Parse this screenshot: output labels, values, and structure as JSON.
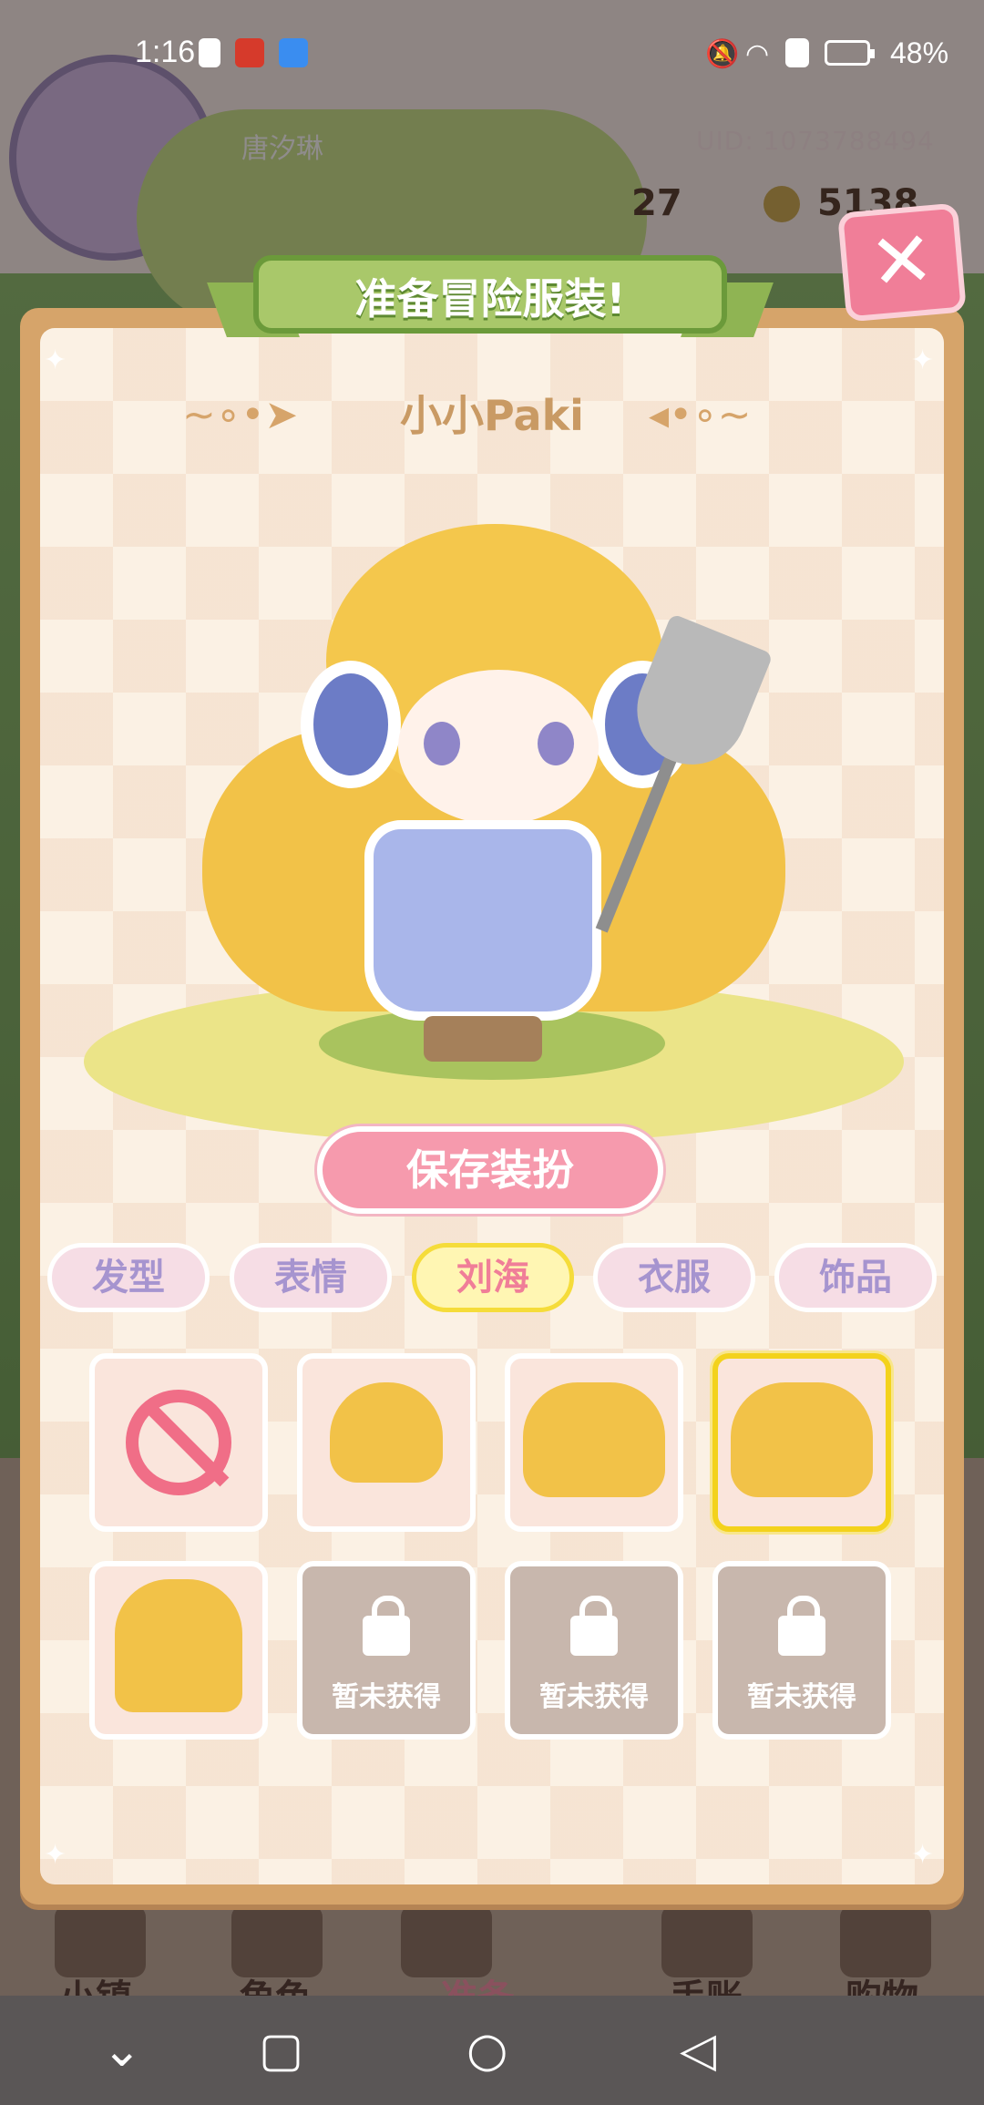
{
  "status_bar": {
    "time": "1:16",
    "battery_percent": "48%"
  },
  "background": {
    "player_name": "唐汐琳",
    "uid": "UID: 1073788494",
    "level": "27",
    "coins": "5138",
    "nav": [
      {
        "label": "小镇"
      },
      {
        "label": "角色"
      },
      {
        "label": "准备"
      },
      {
        "label": "手账"
      },
      {
        "label": "购物"
      }
    ]
  },
  "modal": {
    "title": "准备冒险服装!",
    "character_name": "小小Paki",
    "save_label": "保存装扮",
    "tabs": [
      {
        "label": "发型",
        "active": false
      },
      {
        "label": "表情",
        "active": false
      },
      {
        "label": "刘海",
        "active": true
      },
      {
        "label": "衣服",
        "active": false
      },
      {
        "label": "饰品",
        "active": false
      }
    ],
    "locked_label": "暂未获得",
    "items": [
      {
        "type": "none",
        "selected": false
      },
      {
        "type": "hair",
        "selected": false
      },
      {
        "type": "hair",
        "selected": false
      },
      {
        "type": "hair",
        "selected": true
      },
      {
        "type": "hair",
        "selected": false
      },
      {
        "type": "locked"
      },
      {
        "type": "locked"
      },
      {
        "type": "locked"
      }
    ]
  },
  "colors": {
    "accent_pink": "#f07e98",
    "ribbon_green": "#a9c86a",
    "frame_tan": "#d6a46a",
    "selected_yellow": "#f3d21c"
  }
}
